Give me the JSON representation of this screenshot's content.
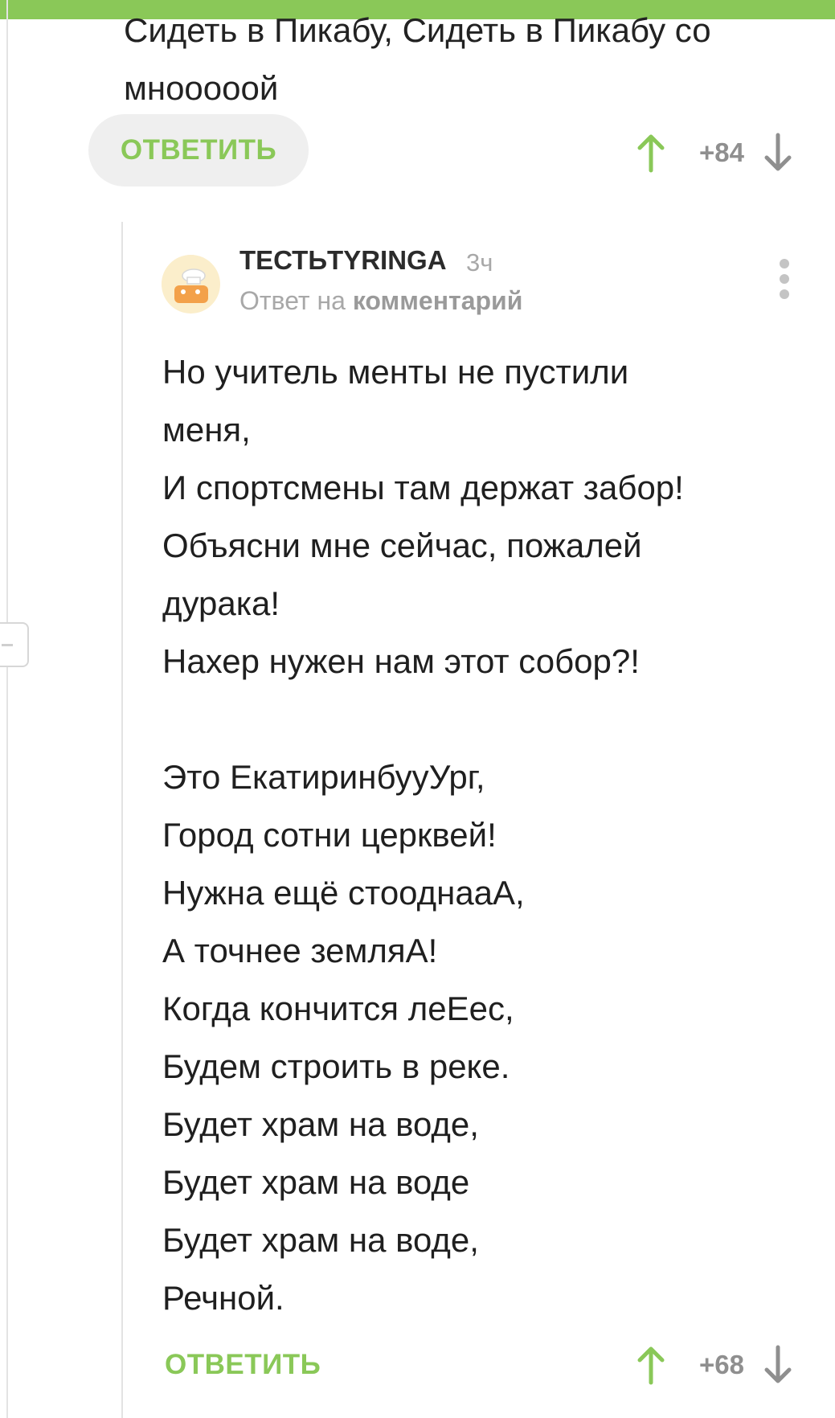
{
  "parent_comment": {
    "text_lines": [
      "Сидеть в Пикабу, Сидеть в Пикабу со",
      "мнооооой"
    ],
    "reply_label": "ОТВЕТИТЬ",
    "score": "+84"
  },
  "comment": {
    "author": "ТЕСТЬTYRINGA",
    "time": "3ч",
    "reply_prefix": "Ответ на",
    "reply_link": "комментарий",
    "avatar_icon": "chef-hat-avatar-icon",
    "text_lines": [
      "Но учитель менты не пустили",
      "меня,",
      "И спортсмены там держат забор!",
      "Объясни мне сейчас, пожалей",
      "дурака!",
      "Нахер нужен нам этот собор?!",
      "",
      "Это ЕкатиринбууУрг,",
      "Город сотни церквей!",
      "Нужна ещё стооднааА,",
      "А точнее земляА!",
      "Когда кончится леЕес,",
      "Будем строить в реке.",
      "Будет храм на воде,",
      "Будет храм на воде",
      "Будет храм на воде,",
      "Речной."
    ],
    "reply_label": "ОТВЕТИТЬ",
    "score": "+68"
  },
  "colors": {
    "accent_green": "#8ac858",
    "muted_gray": "#a8a8a8"
  }
}
